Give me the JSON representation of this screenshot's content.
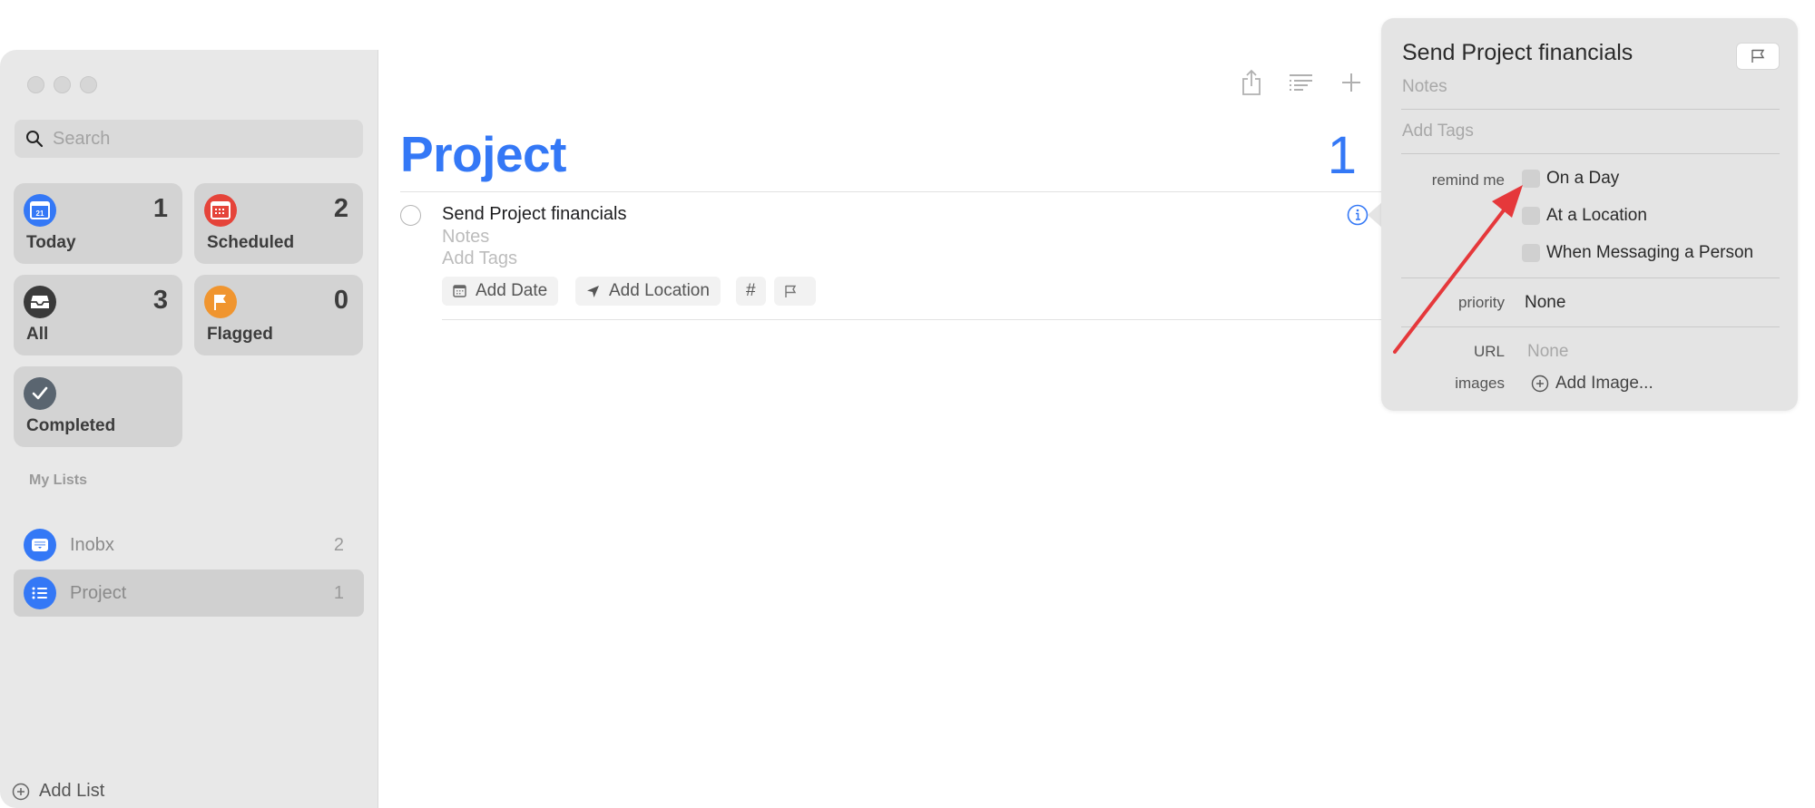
{
  "window": {
    "traffic_lights": [
      "close",
      "minimize",
      "zoom"
    ]
  },
  "sidebar": {
    "search": {
      "placeholder": "Search",
      "value": ""
    },
    "smart_lists": [
      {
        "label": "Today",
        "count": "1",
        "icon": "calendar-today-icon",
        "color": "#3478f6",
        "icon_text": "21"
      },
      {
        "label": "Scheduled",
        "count": "2",
        "icon": "calendar-icon",
        "color": "#e5443a"
      },
      {
        "label": "All",
        "count": "3",
        "icon": "tray-icon",
        "color": "#3a3a3a"
      },
      {
        "label": "Flagged",
        "count": "0",
        "icon": "flag-icon",
        "color": "#f0952f"
      },
      {
        "label": "Completed",
        "count": "",
        "icon": "checkmark-icon",
        "color": "#5a6570"
      }
    ],
    "section_title": "My Lists",
    "lists": [
      {
        "name": "Inobx",
        "count": "2",
        "icon": "tray-icon",
        "selected": false
      },
      {
        "name": "Project",
        "count": "1",
        "icon": "list-bullet-icon",
        "selected": true
      }
    ],
    "add_list_label": "Add List"
  },
  "main": {
    "toolbar": [
      "share-icon",
      "list-options-icon",
      "plus-icon"
    ],
    "title": "Project",
    "count": "1",
    "accent": "#3478f6",
    "tasks": [
      {
        "title": "Send Project financials",
        "notes_placeholder": "Notes",
        "tags_placeholder": "Add Tags",
        "chips": {
          "date": "Add Date",
          "location": "Add Location",
          "tag": "#"
        }
      }
    ]
  },
  "inspector": {
    "title": "Send Project financials",
    "notes_placeholder": "Notes",
    "tags_placeholder": "Add Tags",
    "remind_me_label": "remind me",
    "remind_options": [
      "On a Day",
      "At a Location",
      "When Messaging a Person"
    ],
    "priority_label": "priority",
    "priority_value": "None",
    "url_label": "URL",
    "url_value": "None",
    "images_label": "images",
    "add_image_label": "Add Image..."
  },
  "annotation": {
    "type": "arrow",
    "color": "#e5383b",
    "points_to": "On a Day checkbox"
  }
}
